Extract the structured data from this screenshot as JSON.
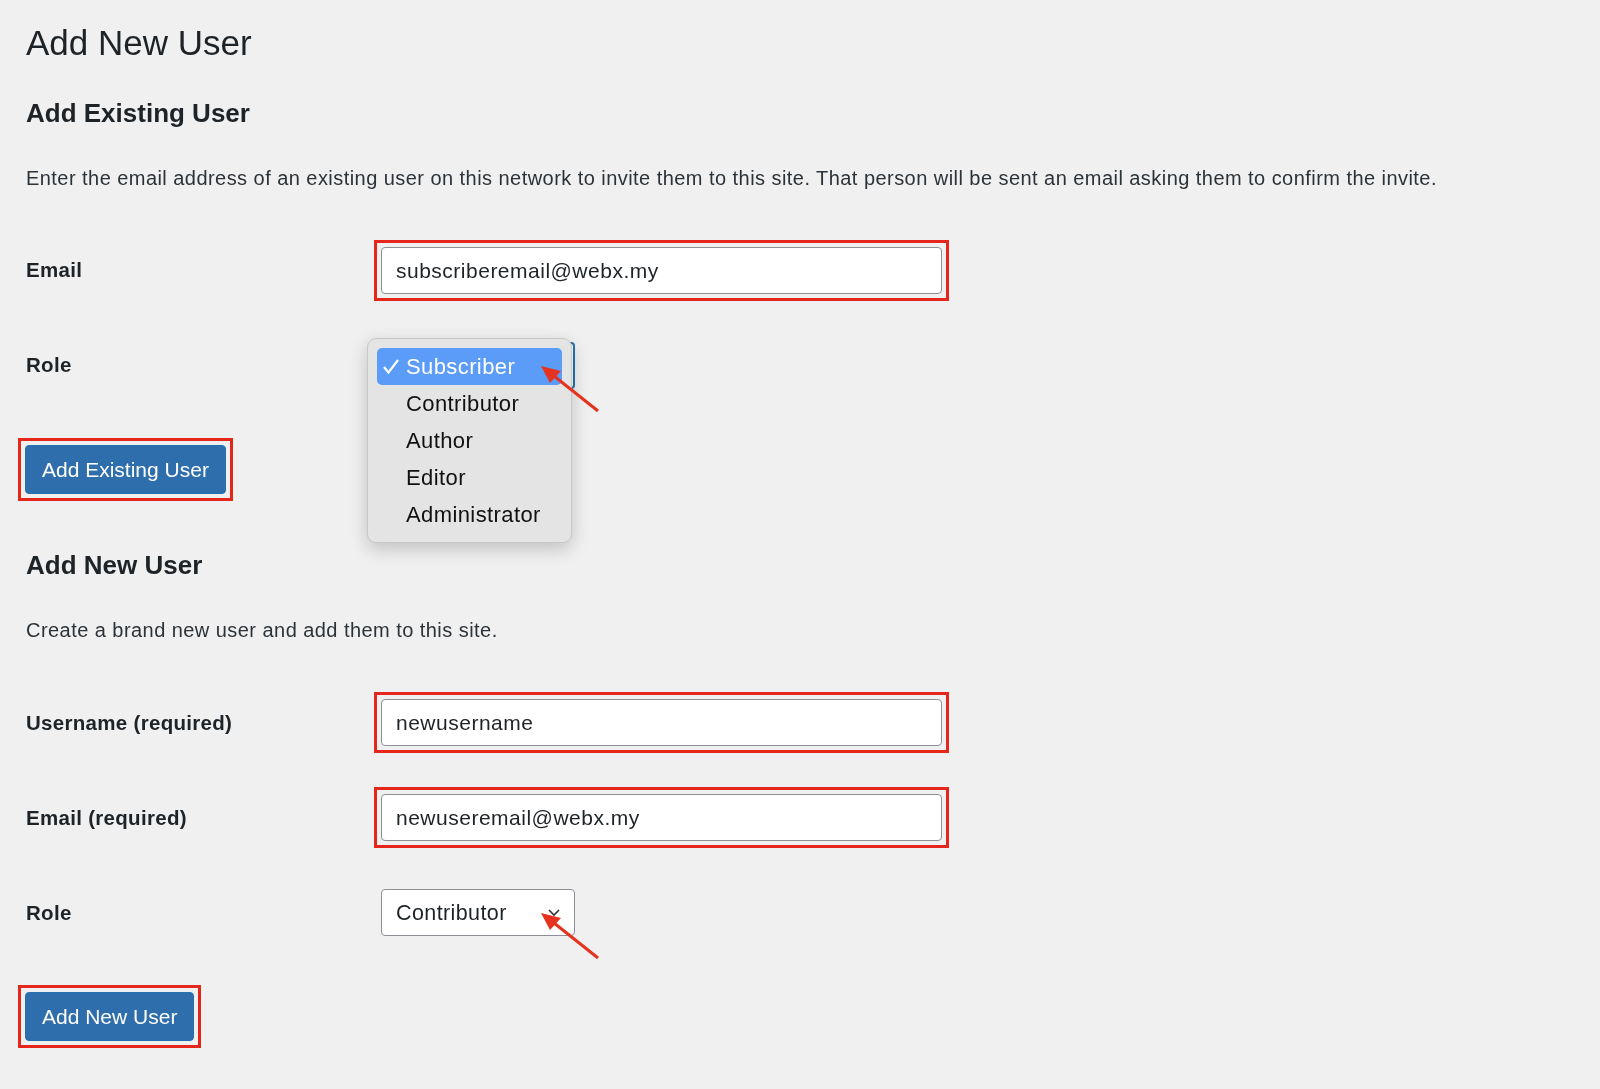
{
  "page_title": "Add New User",
  "sections": [
    {
      "heading": "Add Existing User",
      "description": "Enter the email address of an existing user on this network to invite them to this site. That person will be sent an email asking them to confirm the invite.",
      "fields": [
        {
          "kind": "text",
          "label": "Email",
          "value": "subscriberemail@webx.my",
          "highlighted": true,
          "arrow": false
        },
        {
          "kind": "select",
          "label": "Role",
          "open": true,
          "highlighted": false,
          "arrow": true,
          "options": [
            {
              "label": "Subscriber",
              "selected": true
            },
            {
              "label": "Contributor",
              "selected": false
            },
            {
              "label": "Author",
              "selected": false
            },
            {
              "label": "Editor",
              "selected": false
            },
            {
              "label": "Administrator",
              "selected": false
            }
          ]
        }
      ],
      "button": {
        "label": "Add Existing User",
        "highlighted": true
      }
    },
    {
      "heading": "Add New User",
      "description": "Create a brand new user and add them to this site.",
      "fields": [
        {
          "kind": "text",
          "label": "Username (required)",
          "value": "newusername",
          "highlighted": true,
          "arrow": false
        },
        {
          "kind": "text",
          "label": "Email (required)",
          "value": "newuseremail@webx.my",
          "highlighted": true,
          "arrow": false
        },
        {
          "kind": "select",
          "label": "Role",
          "open": false,
          "highlighted": false,
          "arrow": true,
          "value": "Contributor"
        }
      ],
      "button": {
        "label": "Add New User",
        "highlighted": true
      }
    }
  ]
}
